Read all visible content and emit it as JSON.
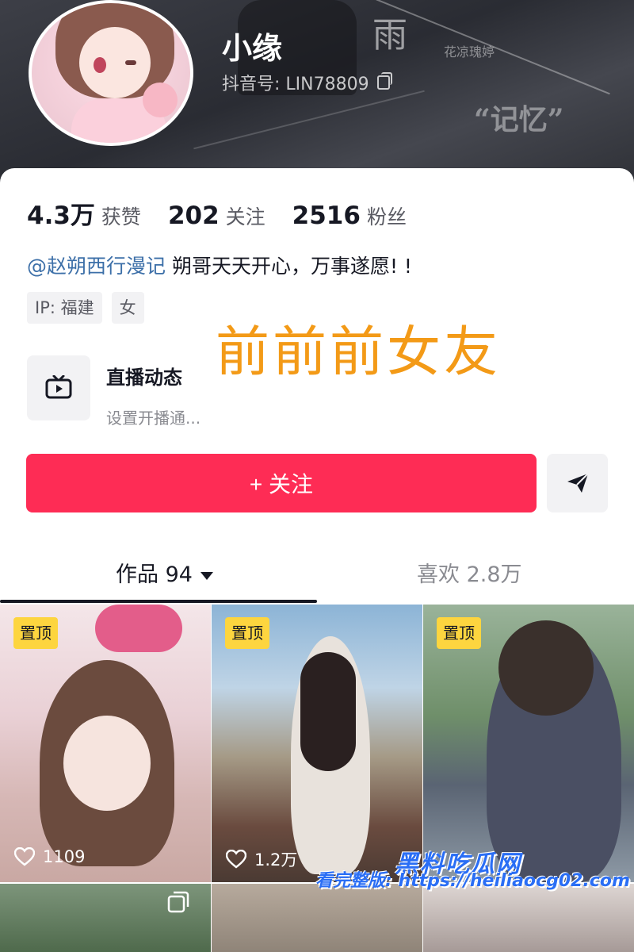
{
  "header": {
    "decor_text_1": "雨",
    "decor_text_2": "花凉瑰婷",
    "decor_text_3": "“记忆”"
  },
  "profile": {
    "name": "小缘",
    "id_label": "抖音号: LIN78809"
  },
  "stats": [
    {
      "value": "4.3万",
      "label": "获赞"
    },
    {
      "value": "202",
      "label": "关注"
    },
    {
      "value": "2516",
      "label": "粉丝"
    }
  ],
  "bio": {
    "mention": "@赵朔西行漫记",
    "text": " 朔哥天天开心，万事遂愿! !"
  },
  "tags": [
    "IP: 福建",
    "女"
  ],
  "overlay_text": "前前前女友",
  "live": {
    "title": "直播动态",
    "subtitle": "设置开播通..."
  },
  "buttons": {
    "follow": "+ 关注"
  },
  "tabs": {
    "works": "作品 94",
    "likes": "喜欢 2.8万"
  },
  "videos": [
    {
      "pinned_label": "置顶",
      "likes": "1109"
    },
    {
      "pinned_label": "置顶",
      "likes": "1.2万"
    },
    {
      "pinned_label": "置顶",
      "likes": ""
    }
  ],
  "watermark": {
    "brand": "黑料吃瓜网",
    "line": "看完整版: https://heiliaocg02.com"
  },
  "icons": {
    "copy": "copy-icon",
    "live": "tv-icon",
    "send": "send-icon",
    "heart": "heart-icon",
    "multi": "multi-photo-icon"
  },
  "colors": {
    "follow_button": "#fe2c55",
    "pinned_badge": "#fdd53f",
    "mention": "#3c6fa8",
    "overlay_text": "#f39a17",
    "watermark": "#2a6ef5"
  }
}
